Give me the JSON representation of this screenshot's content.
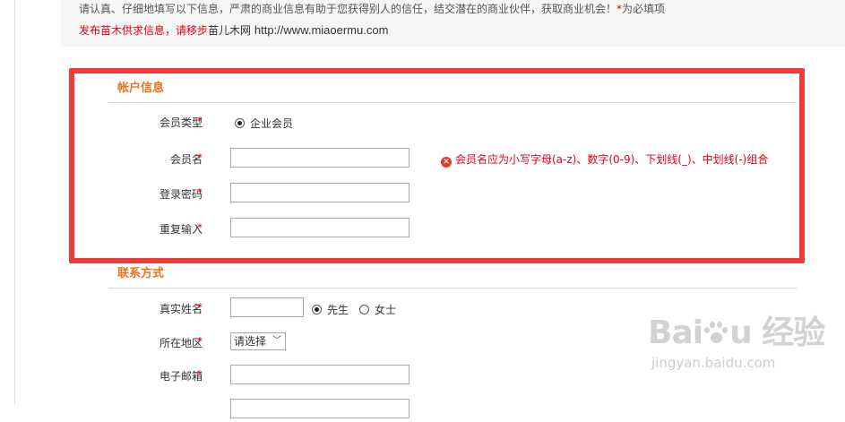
{
  "intro": {
    "text": "请认真、仔细地填写以下信息，严肃的商业信息有助于您获得别人的信任，结交潜在的商业伙伴，获取商业机会！",
    "required_mark": "*",
    "required_note": "为必填项"
  },
  "promo": {
    "link_text": "发布苗木供求信息，请移步",
    "site_name": "苗儿木网",
    "url": "http://www.miaoermu.com"
  },
  "account_section": {
    "title": "帐户信息",
    "member_type": {
      "label": "会员类型",
      "option": "企业会员"
    },
    "member_name": {
      "label": "会员名",
      "value": "",
      "error": "会员名应为小写字母(a-z)、数字(0-9)、下划线(_)、中划线(-)组合"
    },
    "password": {
      "label": "登录密码",
      "value": ""
    },
    "confirm_password": {
      "label": "重复输入",
      "value": ""
    }
  },
  "contact_section": {
    "title": "联系方式",
    "real_name": {
      "label": "真实姓名",
      "value": "",
      "options": [
        "先生",
        "女士"
      ]
    },
    "region": {
      "label": "所在地区",
      "selected": "请选择"
    },
    "email": {
      "label": "电子邮箱",
      "value": ""
    }
  },
  "required_star": "*",
  "watermark": {
    "brand_a": "Bai",
    "brand_b": "u",
    "brand_cn": "经验",
    "site": "jingyan.baidu.com"
  },
  "colors": {
    "required": "#e60012",
    "section_title": "#e8731e",
    "highlight": "#f0393a"
  }
}
